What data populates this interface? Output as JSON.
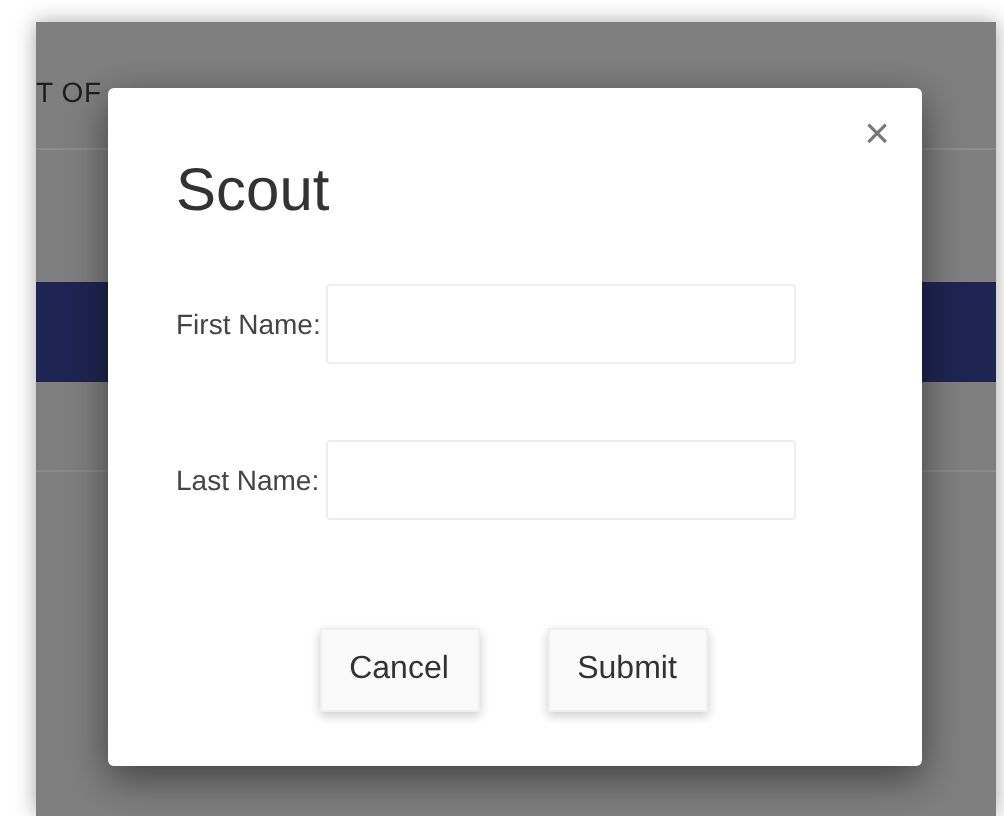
{
  "background": {
    "nav_text": "T OF"
  },
  "modal": {
    "title": "Scout",
    "close": "×",
    "fields": [
      {
        "label": "First Name:"
      },
      {
        "label": "Last Name:"
      }
    ],
    "buttons": [
      "Cancel",
      "Submit"
    ]
  }
}
